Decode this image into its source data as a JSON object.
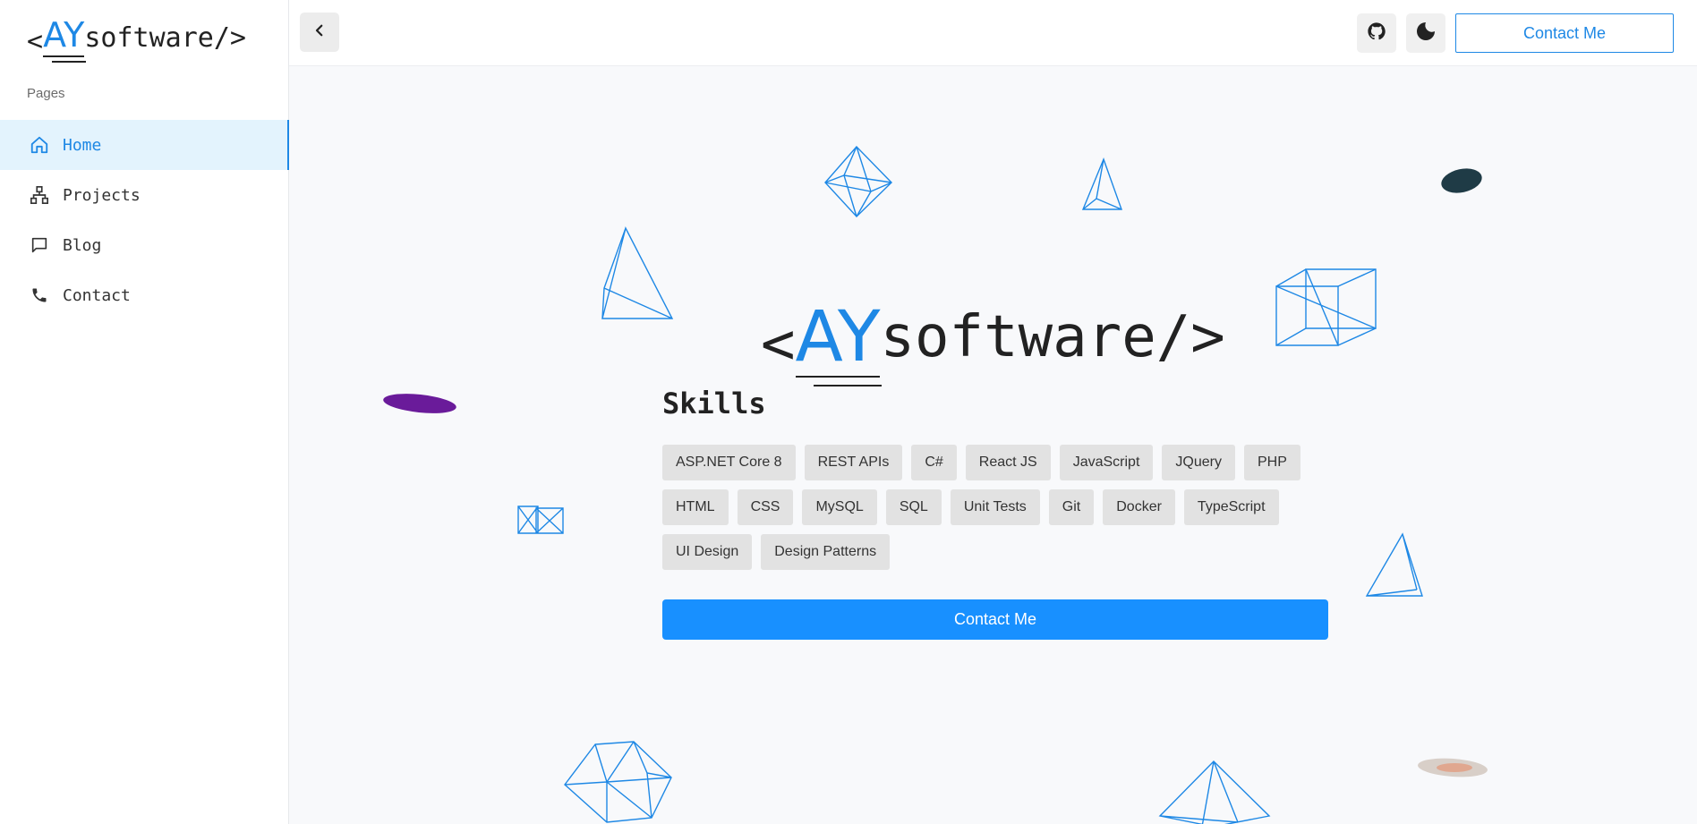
{
  "brand": {
    "prefix": "<",
    "initials": "AY",
    "suffix": "software/>"
  },
  "sidebar": {
    "section_label": "Pages",
    "items": [
      {
        "label": "Home",
        "icon": "home-icon",
        "active": true
      },
      {
        "label": "Projects",
        "icon": "sitemap-icon",
        "active": false
      },
      {
        "label": "Blog",
        "icon": "message-icon",
        "active": false
      },
      {
        "label": "Contact",
        "icon": "phone-icon",
        "active": false
      }
    ]
  },
  "header": {
    "back_icon": "chevron-left-icon",
    "github_icon": "github-icon",
    "theme_icon": "moon-icon",
    "contact_label": "Contact Me"
  },
  "hero": {
    "skills_title": "Skills",
    "skills": [
      "ASP.NET Core 8",
      "REST APIs",
      "C#",
      "React JS",
      "JavaScript",
      "JQuery",
      "PHP",
      "HTML",
      "CSS",
      "MySQL",
      "SQL",
      "Unit Tests",
      "Git",
      "Docker",
      "TypeScript",
      "UI Design",
      "Design Patterns"
    ],
    "contact_label": "Contact Me"
  },
  "colors": {
    "accent": "#1e88e5",
    "primary_button": "#1890ff",
    "active_bg": "#e3f3fd"
  }
}
